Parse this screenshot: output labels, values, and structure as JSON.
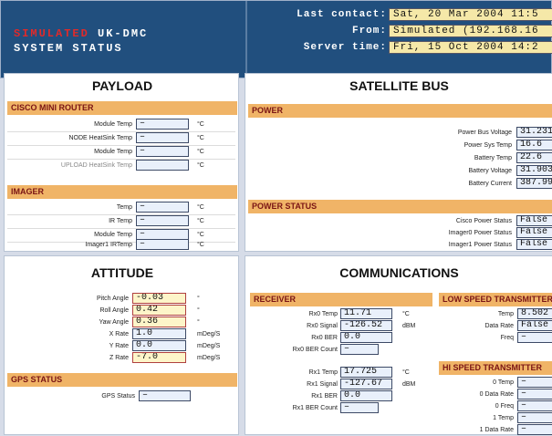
{
  "header": {
    "brand_sim": "SIMULATED",
    "brand_rest": " UK-DMC",
    "brand_line2": "SYSTEM STATUS",
    "rows": [
      {
        "label": "Last contact:",
        "value": "Sat, 20 Mar 2004 11:5"
      },
      {
        "label": "From:",
        "value": "Simulated (192.168.16"
      },
      {
        "label": "Server time:",
        "value": "Fri, 15 Oct 2004 14:2"
      }
    ]
  },
  "payload": {
    "title": "PAYLOAD",
    "router": {
      "title": "CISCO MINI ROUTER",
      "rows": [
        {
          "label": "Module Temp",
          "value": "–",
          "unit": "°C"
        },
        {
          "label": "NODE HeatSink Temp",
          "value": "–",
          "unit": "°C"
        },
        {
          "label": "Module Temp",
          "value": "–",
          "unit": "°C"
        },
        {
          "label": "UPLOAD HeatSink Temp",
          "value": "",
          "unit": "°C"
        }
      ]
    },
    "imager": {
      "title": "IMAGER",
      "rows": [
        {
          "label": "Temp",
          "value": "–",
          "unit": "°C"
        },
        {
          "label": "IR Temp",
          "value": "–",
          "unit": "°C"
        },
        {
          "label": "Module Temp",
          "value": "–",
          "unit": "°C"
        },
        {
          "label": "Imager1 IRTemp",
          "value": "–",
          "unit": "°C"
        }
      ]
    }
  },
  "attitude": {
    "title": "ATTITUDE",
    "rows": [
      {
        "label": "Pitch Angle",
        "value": "-0.03",
        "unit": "°"
      },
      {
        "label": "Roll Angle",
        "value": "0.42",
        "unit": "°"
      },
      {
        "label": "Yaw Angle",
        "value": "0.36",
        "unit": "°"
      },
      {
        "label": "X Rate",
        "value": "1.0",
        "unit": "mDeg/S"
      },
      {
        "label": "Y Rate",
        "value": "0.0",
        "unit": "mDeg/S"
      },
      {
        "label": "Z Rate",
        "value": "-7.0",
        "unit": "mDeg/S"
      }
    ],
    "gps": {
      "title": "GPS STATUS",
      "label": "GPS Status",
      "value": "–"
    }
  },
  "satbus": {
    "title": "SATELLITE BUS",
    "power": {
      "title": "POWER",
      "rows": [
        {
          "label": "Power Bus Voltage",
          "value": "31.2319"
        },
        {
          "label": "Power Sys Temp",
          "value": "16.6"
        },
        {
          "label": "Battery Temp",
          "value": "22.6"
        },
        {
          "label": "Battery Voltage",
          "value": "31.9034"
        },
        {
          "label": "Battery Current",
          "value": "387.998"
        }
      ]
    },
    "status": {
      "title": "POWER STATUS",
      "rows": [
        {
          "label": "Cisco Power Status",
          "value": "False"
        },
        {
          "label": "Imager0 Power Status",
          "value": "False"
        },
        {
          "label": "Imager1 Power Status",
          "value": "False"
        }
      ]
    }
  },
  "comms": {
    "title": "COMMUNICATIONS",
    "receiver": {
      "title": "RECEIVER",
      "rows0": [
        {
          "label": "Rx0 Temp",
          "value": "11.71",
          "unit": "°C"
        },
        {
          "label": "Rx0 Signal",
          "value": "-126.52",
          "unit": "dBM"
        },
        {
          "label": "Rx0 BER",
          "value": "0.0",
          "unit": ""
        },
        {
          "label": "Rx0 BER Count",
          "value": "–",
          "unit": ""
        }
      ],
      "rows1": [
        {
          "label": "Rx1 Temp",
          "value": "17.725",
          "unit": "°C"
        },
        {
          "label": "Rx1 Signal",
          "value": "-127.67",
          "unit": "dBM"
        },
        {
          "label": "Rx1 BER",
          "value": "0.0",
          "unit": ""
        },
        {
          "label": "Rx1 BER Count",
          "value": "–",
          "unit": ""
        }
      ]
    },
    "lowspeed": {
      "title": "LOW SPEED TRANSMITTER",
      "rows": [
        {
          "label": "Temp",
          "value": "8.502"
        },
        {
          "label": "Data Rate",
          "value": "False"
        },
        {
          "label": "Freq",
          "value": "–"
        }
      ]
    },
    "hispeed": {
      "title": "HI SPEED TRANSMITTER",
      "rows": [
        {
          "label": "0 Temp",
          "value": "–"
        },
        {
          "label": "0 Data Rate",
          "value": "–"
        },
        {
          "label": "0 Freq",
          "value": "–"
        },
        {
          "label": "1 Temp",
          "value": "–"
        },
        {
          "label": "1 Data Rate",
          "value": "–"
        }
      ]
    }
  }
}
